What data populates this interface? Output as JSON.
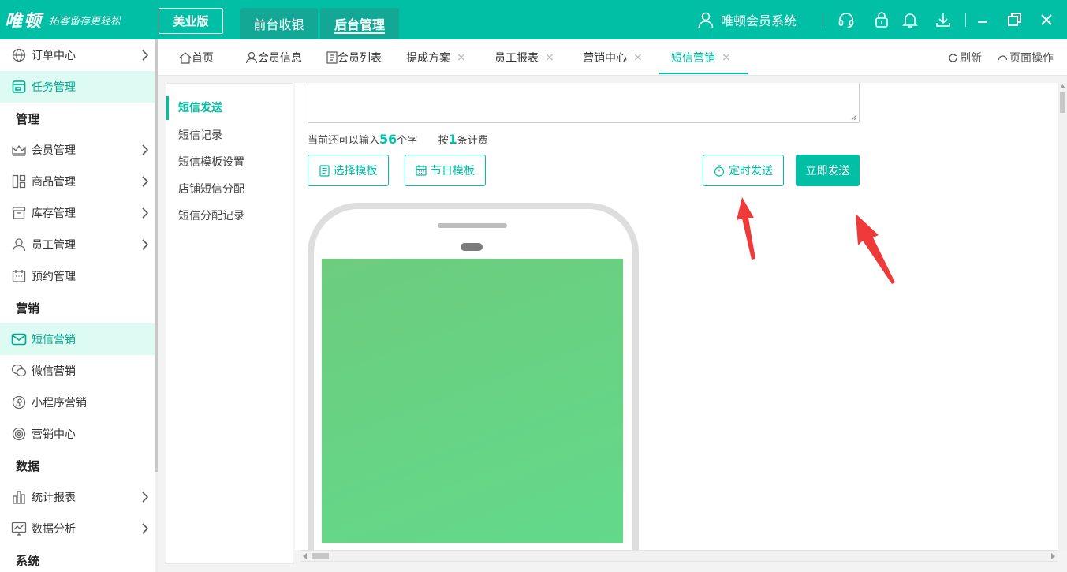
{
  "topbar": {
    "logo_main": "唯顿",
    "logo_sub": "拓客留存更轻松",
    "edition": "美业版",
    "tabs": [
      "前台收银",
      "后台管理"
    ],
    "system_name": "唯顿会员系统",
    "icons": [
      "headset-icon",
      "lock-icon",
      "bell-icon",
      "download-icon",
      "minimize-icon",
      "maximize-icon",
      "close-icon"
    ]
  },
  "sidebar": {
    "items": [
      {
        "label": "订单中心",
        "icon": "globe-icon"
      },
      {
        "label": "任务管理",
        "icon": "task-icon"
      },
      {
        "group": "管理"
      },
      {
        "label": "会员管理",
        "icon": "crown-icon"
      },
      {
        "label": "商品管理",
        "icon": "grid-icon"
      },
      {
        "label": "库存管理",
        "icon": "box-icon"
      },
      {
        "label": "员工管理",
        "icon": "user-icon"
      },
      {
        "label": "预约管理",
        "icon": "calendar-icon"
      },
      {
        "group": "营销"
      },
      {
        "label": "短信营销",
        "icon": "mail-icon"
      },
      {
        "label": "微信营销",
        "icon": "wechat-icon"
      },
      {
        "label": "小程序营销",
        "icon": "miniprogram-icon"
      },
      {
        "label": "营销中心",
        "icon": "target-icon"
      },
      {
        "group": "数据"
      },
      {
        "label": "统计报表",
        "icon": "bar-chart-icon"
      },
      {
        "label": "数据分析",
        "icon": "line-chart-icon"
      },
      {
        "group": "系统"
      }
    ]
  },
  "tabs": {
    "items": [
      "首页",
      "会员信息",
      "会员列表",
      "提成方案",
      "员工报表",
      "营销中心",
      "短信营销"
    ],
    "active": "短信营销",
    "close_glyph": "×",
    "refresh": "刷新",
    "page_ops": "页面操作"
  },
  "subnav": {
    "items": [
      "短信发送",
      "短信记录",
      "短信模板设置",
      "店铺短信分配",
      "短信分配记录"
    ],
    "active": "短信发送"
  },
  "sms": {
    "counter_prefix": "当前还可以输入",
    "remaining": "56",
    "counter_unit": "个字",
    "billing_prefix": "按",
    "billing_count": "1",
    "billing_suffix": "条计费",
    "choose_template": "选择模板",
    "holiday_template": "节日模板",
    "scheduled_send": "定时发送",
    "send_now": "立即发送"
  },
  "colors": {
    "accent": "#00bfa5",
    "active_bg": "#ddfaf3",
    "arrow": "#f03a3a",
    "phone_screen": "#66d383"
  }
}
